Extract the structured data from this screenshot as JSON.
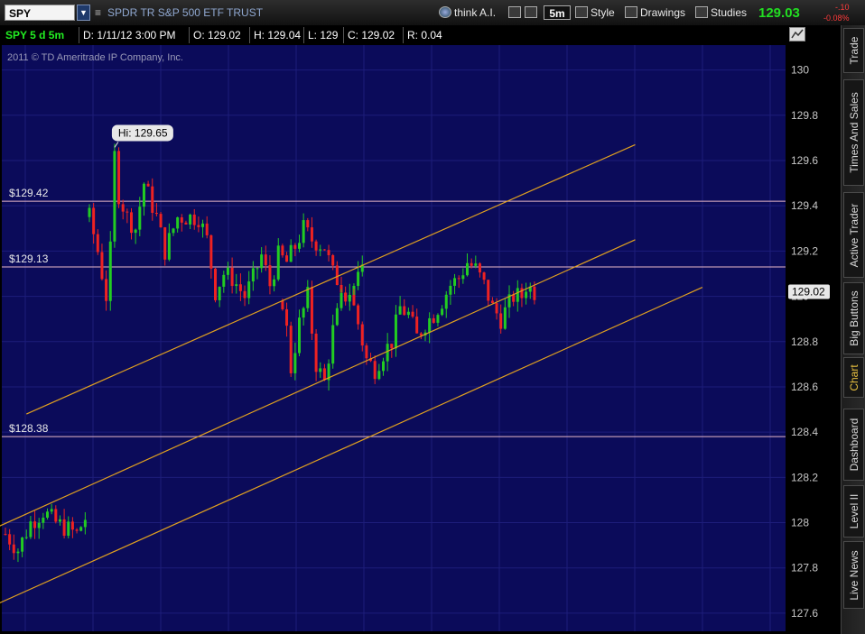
{
  "toolbar": {
    "symbol": "SPY",
    "symbol_name": "SPDR TR S&P 500 ETF TRUST",
    "think_ai": "think A.I.",
    "interval": "5m",
    "style": "Style",
    "drawings": "Drawings",
    "studies": "Studies",
    "last_price": "129.03",
    "change": "-.10",
    "change_pct": "-0.08%"
  },
  "infobar": {
    "symbol_period": "SPY 5 d 5m",
    "date": "D: 1/11/12 3:00 PM",
    "open": "O: 129.02",
    "high": "H: 129.04",
    "low": "L: 129",
    "close": "C: 129.02",
    "range": "R: 0.04"
  },
  "copyright": "2011 © TD Ameritrade IP Company, Inc.",
  "sidebar": {
    "tabs": [
      "Trade",
      "Times And Sales",
      "Active Trader",
      "Big Buttons",
      "Chart",
      "Dashboard",
      "Level II",
      "Live News"
    ],
    "active": "Chart"
  },
  "colors": {
    "background": "#0b0b5a",
    "grid": "#1d1d7a",
    "up": "#22cc22",
    "down": "#ee2222",
    "channel": "#e0a020",
    "level": "#e8b8c8"
  },
  "chart_data": {
    "type": "candlestick",
    "symbol": "SPY",
    "period": "5 d 5m",
    "ylim": [
      127.52,
      130.11
    ],
    "yticks": [
      127.6,
      127.8,
      128,
      128.2,
      128.4,
      128.6,
      128.8,
      129,
      129.2,
      129.4,
      129.6,
      129.8,
      130
    ],
    "current_price": 129.02,
    "annotations": {
      "high_label": "Hi: 129.65",
      "high_value": 129.65
    },
    "horizontal_levels": [
      {
        "value": 129.42,
        "label": "$129.42"
      },
      {
        "value": 129.13,
        "label": "$129.13"
      },
      {
        "value": 128.38,
        "label": "$128.38"
      }
    ],
    "channel_lines": [
      {
        "start": {
          "bar": 5,
          "price": 128.48
        },
        "end": {
          "bar": 150,
          "price": 129.67
        }
      },
      {
        "start": {
          "bar": -2,
          "price": 127.98
        },
        "end": {
          "bar": 150,
          "price": 129.25
        }
      },
      {
        "start": {
          "bar": -2,
          "price": 127.64
        },
        "end": {
          "bar": 166,
          "price": 129.04
        }
      }
    ],
    "segments": [
      {
        "start_bar": 0,
        "points": [
          [
            0,
            127.95
          ],
          [
            3,
            127.88
          ],
          [
            6,
            128.0
          ],
          [
            9,
            128.05
          ],
          [
            12,
            128.0
          ],
          [
            14,
            127.98
          ],
          [
            17,
            127.95
          ],
          [
            19,
            128.02
          ]
        ]
      },
      {
        "start_bar": 20,
        "points": [
          [
            0,
            129.35
          ],
          [
            2,
            129.2
          ],
          [
            4,
            129.0
          ],
          [
            5,
            129.2
          ],
          [
            6,
            129.62
          ],
          [
            7,
            129.45
          ],
          [
            9,
            129.35
          ],
          [
            11,
            129.3
          ],
          [
            13,
            129.5
          ],
          [
            16,
            129.35
          ],
          [
            18,
            129.2
          ],
          [
            21,
            129.35
          ],
          [
            26,
            129.35
          ],
          [
            28,
            129.25
          ],
          [
            30,
            129.02
          ],
          [
            32,
            129.1
          ],
          [
            34,
            129.08
          ],
          [
            37,
            129.0
          ],
          [
            39,
            129.08
          ],
          [
            41,
            129.18
          ],
          [
            43,
            129.05
          ],
          [
            45,
            129.18
          ],
          [
            47,
            129.15
          ],
          [
            49,
            129.22
          ],
          [
            51,
            129.3
          ],
          [
            53,
            129.25
          ],
          [
            56,
            129.22
          ],
          [
            58,
            129.1
          ],
          [
            60,
            129.05
          ],
          [
            62,
            129.02
          ],
          [
            65,
            129.1
          ]
        ]
      },
      {
        "start_bar": 66,
        "points": [
          [
            0,
            128.98
          ],
          [
            1,
            128.85
          ],
          [
            2,
            128.68
          ],
          [
            4,
            128.88
          ],
          [
            6,
            129.0
          ],
          [
            8,
            128.7
          ],
          [
            10,
            128.62
          ],
          [
            12,
            128.85
          ],
          [
            14,
            128.98
          ],
          [
            16,
            129.02
          ],
          [
            18,
            128.88
          ],
          [
            20,
            128.72
          ],
          [
            22,
            128.68
          ],
          [
            24,
            128.75
          ],
          [
            26,
            128.8
          ],
          [
            28,
            128.95
          ],
          [
            30,
            128.92
          ],
          [
            32,
            128.82
          ],
          [
            34,
            128.88
          ],
          [
            36,
            128.92
          ],
          [
            38,
            128.98
          ],
          [
            40,
            129.05
          ],
          [
            42,
            129.08
          ],
          [
            44,
            129.15
          ],
          [
            46,
            129.12
          ],
          [
            48,
            129.05
          ],
          [
            50,
            128.95
          ],
          [
            52,
            128.9
          ],
          [
            55,
            129.0
          ],
          [
            57,
            129.0
          ],
          [
            58,
            129.05
          ],
          [
            60,
            129.02
          ]
        ]
      }
    ],
    "last_bar_time": "1/11/12 3:00 PM"
  }
}
